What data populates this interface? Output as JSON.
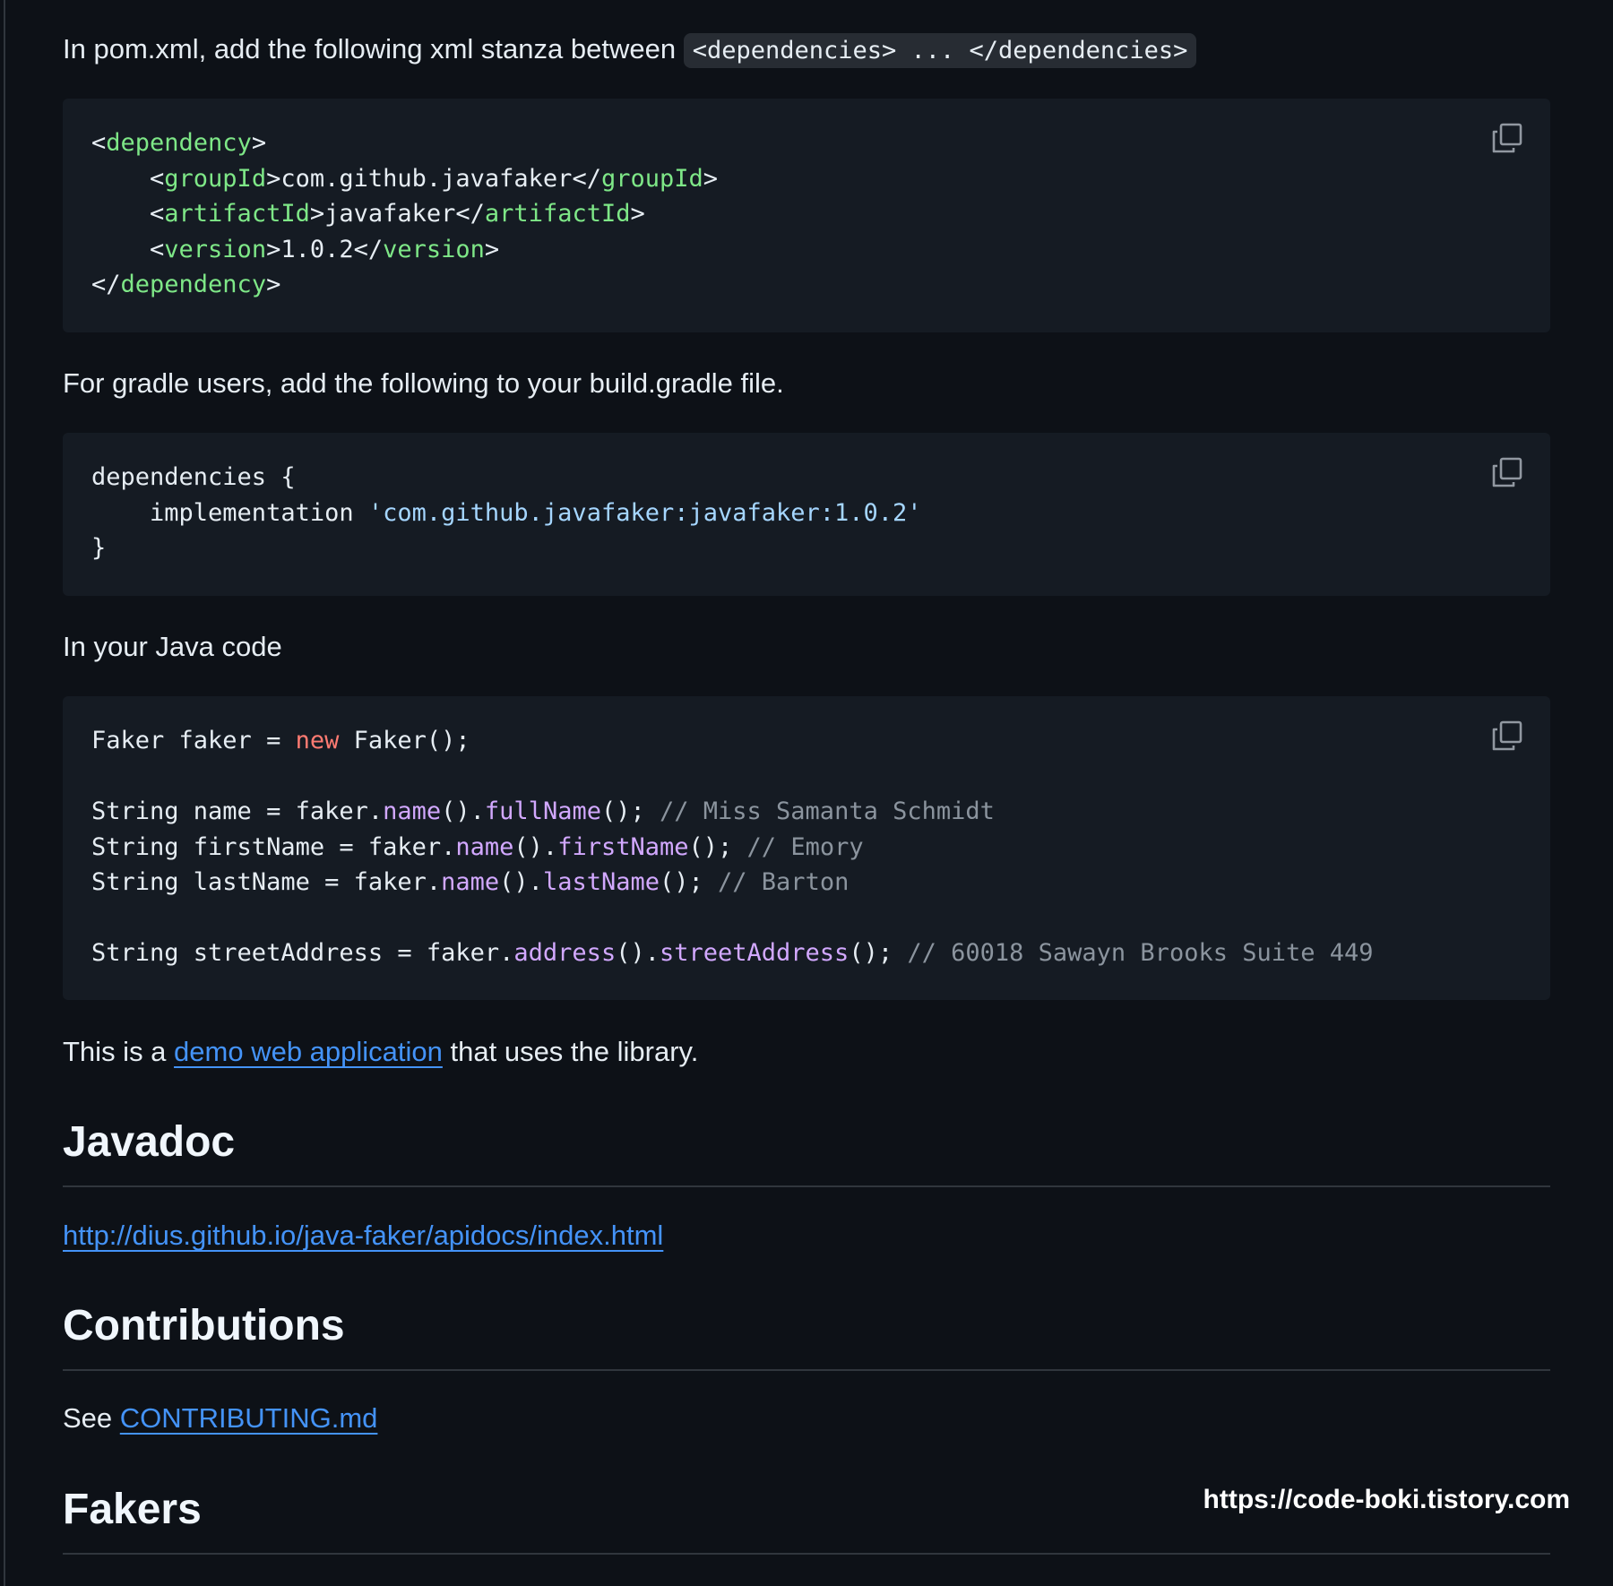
{
  "intro_pom": {
    "text": "In pom.xml, add the following xml stanza between ",
    "code": "<dependencies> ... </dependencies>"
  },
  "maven_block": {
    "lines": [
      [
        {
          "t": "<",
          "c": ""
        },
        {
          "t": "dependency",
          "c": "tag"
        },
        {
          "t": ">",
          "c": ""
        }
      ],
      [
        {
          "t": "    <",
          "c": ""
        },
        {
          "t": "groupId",
          "c": "tag"
        },
        {
          "t": ">com.github.javafaker</",
          "c": ""
        },
        {
          "t": "groupId",
          "c": "tag"
        },
        {
          "t": ">",
          "c": ""
        }
      ],
      [
        {
          "t": "    <",
          "c": ""
        },
        {
          "t": "artifactId",
          "c": "tag"
        },
        {
          "t": ">javafaker</",
          "c": ""
        },
        {
          "t": "artifactId",
          "c": "tag"
        },
        {
          "t": ">",
          "c": ""
        }
      ],
      [
        {
          "t": "    <",
          "c": ""
        },
        {
          "t": "version",
          "c": "tag"
        },
        {
          "t": ">1.0.2</",
          "c": ""
        },
        {
          "t": "version",
          "c": "tag"
        },
        {
          "t": ">",
          "c": ""
        }
      ],
      [
        {
          "t": "</",
          "c": ""
        },
        {
          "t": "dependency",
          "c": "tag"
        },
        {
          "t": ">",
          "c": ""
        }
      ]
    ]
  },
  "intro_gradle": {
    "text": "For gradle users, add the following to your build.gradle file."
  },
  "gradle_block": {
    "lines": [
      [
        {
          "t": "dependencies {",
          "c": ""
        }
      ],
      [
        {
          "t": "    implementation ",
          "c": ""
        },
        {
          "t": "'com.github.javafaker:javafaker:1.0.2'",
          "c": "str"
        }
      ],
      [
        {
          "t": "}",
          "c": ""
        }
      ]
    ]
  },
  "intro_java": {
    "text": "In your Java code"
  },
  "java_block": {
    "lines": [
      [
        {
          "t": "Faker faker = ",
          "c": ""
        },
        {
          "t": "new",
          "c": "kw"
        },
        {
          "t": " Faker();",
          "c": ""
        }
      ],
      [
        {
          "t": "",
          "c": ""
        }
      ],
      [
        {
          "t": "String name = faker.",
          "c": ""
        },
        {
          "t": "name",
          "c": "fn"
        },
        {
          "t": "().",
          "c": ""
        },
        {
          "t": "fullName",
          "c": "fn"
        },
        {
          "t": "(); ",
          "c": ""
        },
        {
          "t": "// Miss Samanta Schmidt",
          "c": "cm"
        }
      ],
      [
        {
          "t": "String firstName = faker.",
          "c": ""
        },
        {
          "t": "name",
          "c": "fn"
        },
        {
          "t": "().",
          "c": ""
        },
        {
          "t": "firstName",
          "c": "fn"
        },
        {
          "t": "(); ",
          "c": ""
        },
        {
          "t": "// Emory",
          "c": "cm"
        }
      ],
      [
        {
          "t": "String lastName = faker.",
          "c": ""
        },
        {
          "t": "name",
          "c": "fn"
        },
        {
          "t": "().",
          "c": ""
        },
        {
          "t": "lastName",
          "c": "fn"
        },
        {
          "t": "(); ",
          "c": ""
        },
        {
          "t": "// Barton",
          "c": "cm"
        }
      ],
      [
        {
          "t": "",
          "c": ""
        }
      ],
      [
        {
          "t": "String streetAddress = faker.",
          "c": ""
        },
        {
          "t": "address",
          "c": "fn"
        },
        {
          "t": "().",
          "c": ""
        },
        {
          "t": "streetAddress",
          "c": "fn"
        },
        {
          "t": "(); ",
          "c": ""
        },
        {
          "t": "// 60018 Sawayn Brooks Suite 449",
          "c": "cm"
        }
      ]
    ]
  },
  "demo": {
    "before": "This is a ",
    "link": "demo web application",
    "after": " that uses the library."
  },
  "javadoc": {
    "heading": "Javadoc",
    "link": "http://dius.github.io/java-faker/apidocs/index.html"
  },
  "contributions": {
    "heading": "Contributions",
    "before": "See ",
    "link": "CONTRIBUTING.md"
  },
  "fakers": {
    "heading": "Fakers"
  },
  "watermark": "https://code-boki.tistory.com",
  "icons": {
    "copy": "copy-icon"
  },
  "colors": {
    "background": "#0d1117",
    "code_bg": "#151b23",
    "link": "#4493f8",
    "tag": "#7ee787",
    "string": "#a5d6ff",
    "keyword": "#ff7b72",
    "function": "#d2a8ff",
    "comment": "#8b949e"
  }
}
